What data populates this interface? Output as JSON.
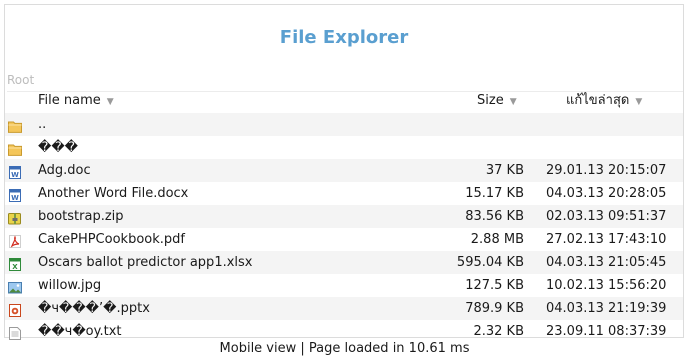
{
  "title": "File Explorer",
  "root": "Root",
  "columns": {
    "name": "File name",
    "size": "Size",
    "modified": "แก้ไขล่าสุด"
  },
  "sort_glyph": "▼",
  "rows": [
    {
      "icon": "folder-icon",
      "name": "..",
      "size": "",
      "date": ""
    },
    {
      "icon": "folder-icon",
      "name": "���",
      "size": "",
      "date": ""
    },
    {
      "icon": "word-doc-icon",
      "name": "Adg.doc",
      "size": "37 KB",
      "date": "29.01.13 20:15:07"
    },
    {
      "icon": "word-doc-icon",
      "name": "Another Word File.docx",
      "size": "15.17 KB",
      "date": "04.03.13 20:28:05"
    },
    {
      "icon": "zip-archive-icon",
      "name": "bootstrap.zip",
      "size": "83.56 KB",
      "date": "02.03.13 09:51:37"
    },
    {
      "icon": "pdf-icon",
      "name": "CakePHPCookbook.pdf",
      "size": "2.88 MB",
      "date": "27.02.13 17:43:10"
    },
    {
      "icon": "excel-icon",
      "name": "Oscars ballot predictor app1.xlsx",
      "size": "595.04 KB",
      "date": "04.03.13 21:05:45"
    },
    {
      "icon": "image-icon",
      "name": "willow.jpg",
      "size": "127.5 KB",
      "date": "10.02.13 15:56:20"
    },
    {
      "icon": "powerpoint-icon",
      "name": "�ч���’�.pptx",
      "size": "789.9 KB",
      "date": "04.03.13 21:19:39"
    },
    {
      "icon": "text-file-icon",
      "name": "��ч�oy.txt",
      "size": "2.32 KB",
      "date": "23.09.11 08:37:39"
    }
  ],
  "footer": {
    "view_link": "Mobile view",
    "separator": "|",
    "load_text": "Page loaded in 10.61 ms"
  }
}
